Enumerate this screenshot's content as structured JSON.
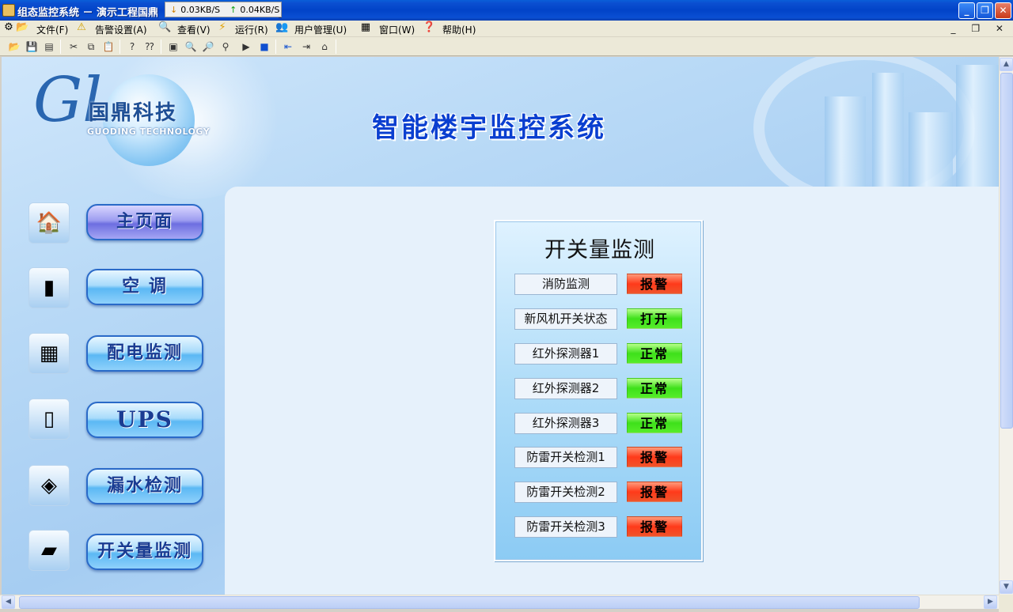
{
  "window": {
    "title": "组态监控系统 － 演示工程国鼎",
    "title_tail": "]",
    "net_down": "0.03KB/S",
    "net_up": "0.04KB/S",
    "minimize": "_",
    "maximize": "❐",
    "close": "✕"
  },
  "menu": {
    "items": [
      {
        "label": "文件(F)"
      },
      {
        "label": "告警设置(A)"
      },
      {
        "label": "查看(V)"
      },
      {
        "label": "运行(R)"
      },
      {
        "label": "用户管理(U)"
      },
      {
        "label": "窗口(W)"
      },
      {
        "label": "帮助(H)"
      }
    ],
    "mdi_controls": "_ ❐ ✕"
  },
  "logo": {
    "mark": "Gl",
    "name": "国鼎科技",
    "subtitle": "GUODING TECHNOLOGY"
  },
  "system_title": "智能楼宇监控系统",
  "nav": [
    {
      "label": "主页面",
      "icon": "house-icon",
      "active": true
    },
    {
      "label": "空 调",
      "icon": "air-conditioner-icon",
      "active": false
    },
    {
      "label": "配电监测",
      "icon": "power-meter-icon",
      "active": false
    },
    {
      "label": "UPS",
      "icon": "ups-icon",
      "active": false
    },
    {
      "label": "漏水检测",
      "icon": "leak-sensor-icon",
      "active": false
    },
    {
      "label": "开关量监测",
      "icon": "io-module-icon",
      "active": false
    }
  ],
  "monitor": {
    "title": "开关量监测",
    "rows": [
      {
        "label": "消防监测",
        "status": "报警",
        "state": "alarm"
      },
      {
        "label": "新风机开关状态",
        "status": "打开",
        "state": "ok"
      },
      {
        "label": "红外探测器1",
        "status": "正常",
        "state": "ok"
      },
      {
        "label": "红外探测器2",
        "status": "正常",
        "state": "ok"
      },
      {
        "label": "红外探测器3",
        "status": "正常",
        "state": "ok"
      },
      {
        "label": "防雷开关检测1",
        "status": "报警",
        "state": "alarm"
      },
      {
        "label": "防雷开关检测2",
        "status": "报警",
        "state": "alarm"
      },
      {
        "label": "防雷开关检测3",
        "status": "报警",
        "state": "alarm"
      }
    ]
  },
  "colors": {
    "alarm": "#ff3a1a",
    "ok": "#3ee01a",
    "title_blue": "#0a3fd0"
  }
}
